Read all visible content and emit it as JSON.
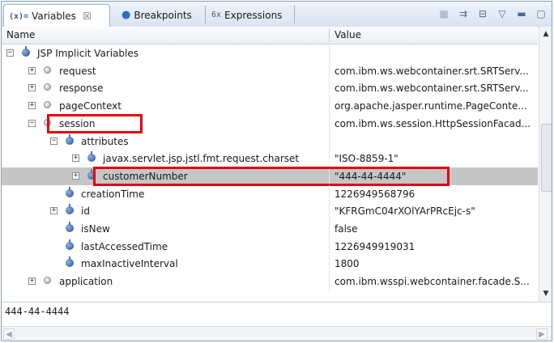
{
  "tabs": [
    {
      "label": "Variables",
      "icon": "variables-icon",
      "icon_text": "(x)=",
      "close": "☒"
    },
    {
      "label": "Breakpoints",
      "icon": "breakpoints-icon"
    },
    {
      "label": "Expressions",
      "icon": "expressions-icon",
      "icon_text": "6x"
    }
  ],
  "toolbar": [
    {
      "icon": "show-type-names-icon"
    },
    {
      "icon": "show-logical-structure-icon"
    },
    {
      "icon": "collapse-all-icon"
    },
    {
      "icon": "view-menu-icon"
    },
    {
      "icon": "minimize-icon"
    },
    {
      "icon": "maximize-icon"
    }
  ],
  "columns": {
    "name": "Name",
    "value": "Value"
  },
  "rows": [
    {
      "name": "JSP Implicit Variables",
      "value": "",
      "depth": 0,
      "expander": "minus",
      "icon": "object-icon"
    },
    {
      "name": "request",
      "value": "com.ibm.ws.webcontainer.srt.SRTServ...",
      "depth": 1,
      "expander": "plus",
      "icon": "protected-field-icon"
    },
    {
      "name": "response",
      "value": "com.ibm.ws.webcontainer.srt.SRTServ...",
      "depth": 1,
      "expander": "plus",
      "icon": "protected-field-icon"
    },
    {
      "name": "pageContext",
      "value": "org.apache.jasper.runtime.PageConte...",
      "depth": 1,
      "expander": "plus",
      "icon": "protected-field-icon"
    },
    {
      "name": "session",
      "value": "com.ibm.ws.session.HttpSessionFacad...",
      "depth": 1,
      "expander": "minus",
      "icon": "protected-field-icon",
      "highlighted": true
    },
    {
      "name": "attributes",
      "value": "",
      "depth": 2,
      "expander": "minus",
      "icon": "object-icon"
    },
    {
      "name": "javax.servlet.jsp.jstl.fmt.request.charset",
      "value": "\"ISO-8859-1\"",
      "depth": 3,
      "expander": "plus",
      "icon": "object-icon"
    },
    {
      "name": "customerNumber",
      "value": "\"444-44-4444\"",
      "depth": 3,
      "expander": "plus",
      "icon": "object-icon",
      "selected": true,
      "highlighted": true
    },
    {
      "name": "creationTime",
      "value": "1226949568796",
      "depth": 2,
      "expander": "none",
      "icon": "object-icon"
    },
    {
      "name": "id",
      "value": "\"KFRGmC04rXOlYArPRcEjc-s\"",
      "depth": 2,
      "expander": "plus",
      "icon": "object-icon"
    },
    {
      "name": "isNew",
      "value": "false",
      "depth": 2,
      "expander": "none",
      "icon": "object-icon"
    },
    {
      "name": "lastAccessedTime",
      "value": "1226949919031",
      "depth": 2,
      "expander": "none",
      "icon": "object-icon"
    },
    {
      "name": "maxInactiveInterval",
      "value": "1800",
      "depth": 2,
      "expander": "none",
      "icon": "object-icon"
    },
    {
      "name": "application",
      "value": "com.ibm.wsspi.webcontainer.facade.S...",
      "depth": 1,
      "expander": "plus",
      "icon": "protected-field-icon"
    }
  ],
  "detail": {
    "text": "444-44-4444"
  },
  "colors": {
    "highlight": "#e3000f",
    "selection": "#c6c6c6",
    "accent": "#1f4c94"
  }
}
